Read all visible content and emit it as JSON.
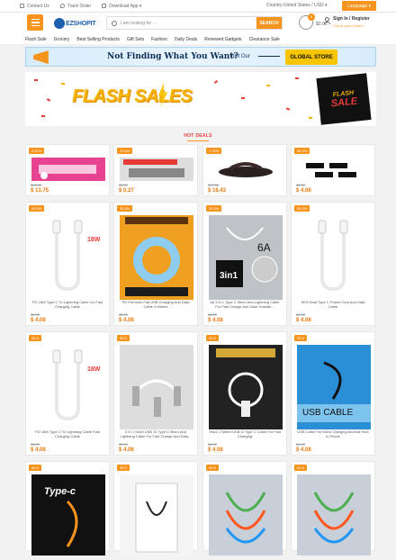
{
  "topbar": {
    "contact": "Contact Us",
    "track": "Track Order",
    "download": "Download App",
    "country": "Country United States / USD",
    "language": "Language"
  },
  "header": {
    "logo": "EZSHOPIT",
    "search_placeholder": "I am looking for ...",
    "search_button": "SEARCH",
    "cart_count": "0",
    "cart_amount": "$0.00",
    "signin": "Sign In / Register",
    "signin_sub": "Check your Orders"
  },
  "nav": [
    "Flash Sale",
    "Grocery",
    "Best Selling Products",
    "Gift Sets",
    "Fashion",
    "Daily Deals",
    "Renewed Gadgets",
    "Clearance Sale"
  ],
  "banner1": {
    "text": "Not Finding What You Want?",
    "visit": "Visit Our",
    "store": "GLOBAL STORE"
  },
  "banner2": {
    "text": "FLASH SALES",
    "badge_top": "FLASH",
    "badge_bottom": "SALE"
  },
  "hot_deals_title": "HOT DEALS",
  "products": [
    {
      "disc": "0.21%",
      "name": "",
      "old": "$13.80",
      "price": "$ 13.75",
      "img": "banner"
    },
    {
      "disc": "72.6%",
      "name": "",
      "old": "$1.00",
      "price": "$ 0.27",
      "img": "banner2"
    },
    {
      "disc": "7.75%",
      "name": "",
      "old": "$17.82",
      "price": "$ 16.43",
      "img": "sandal"
    },
    {
      "disc": "36.2%",
      "name": "",
      "old": "$6.40",
      "price": "$ 4.08",
      "img": "adapters"
    },
    {
      "disc": "39.3%",
      "name": "PD 18W Type C To Lightning Cable 1m Fast Charging Cable",
      "old": "$6.72",
      "price": "$ 4.08",
      "img": "cable-white"
    },
    {
      "disc": "39.3%",
      "name": "PD Premium Flat USB Charging And Data Cable 3 Meters",
      "old": "$6.72",
      "price": "$ 4.08",
      "img": "flat-box"
    },
    {
      "disc": "39.3%",
      "name": "6A 3 in 1 Type C Micro And Lightning Cable For Fast Charge And Data Transfer...",
      "old": "$6.72",
      "price": "$ 4.08",
      "img": "3in1-box"
    },
    {
      "disc": "39.3%",
      "name": "SEN Dual Type C Power Cord And Data Cable",
      "old": "$6.72",
      "price": "$ 4.08",
      "img": "cable-white2"
    },
    {
      "disc": "39.3",
      "name": "PD 18W Type C To Lightning Cable Fast Charging Cable",
      "old": "$6.72",
      "price": "$ 4.08",
      "img": "cable-white3"
    },
    {
      "disc": "39.3",
      "name": "3 In 1 Short USB To Type C Micro And Lightning Cable For Fast Charge And Data...",
      "old": "$6.72",
      "price": "$ 4.08",
      "img": "short-cable"
    },
    {
      "disc": "39.3",
      "name": "Tesco 2 Meter USB to Type C Cable For Fast Charging",
      "old": "$6.72",
      "price": "$ 4.08",
      "img": "tesco-box"
    },
    {
      "disc": "39.3",
      "name": "USB Cable For Micro Charging Android Hobi Iv Phone",
      "old": "$6.72",
      "price": "$ 4.08",
      "img": "ivon-box"
    },
    {
      "disc": "39.3",
      "name": "",
      "old": "",
      "price": "",
      "img": "typec-box"
    },
    {
      "disc": "39.3",
      "name": "",
      "old": "",
      "price": "",
      "img": "white-box"
    },
    {
      "disc": "39.3",
      "name": "",
      "old": "",
      "price": "",
      "img": "led-box"
    },
    {
      "disc": "39.3",
      "name": "",
      "old": "",
      "price": "",
      "img": "led-box2"
    }
  ],
  "colors": {
    "accent": "#f7941d",
    "brand": "#1c5fae",
    "price": "#e87a0c"
  }
}
